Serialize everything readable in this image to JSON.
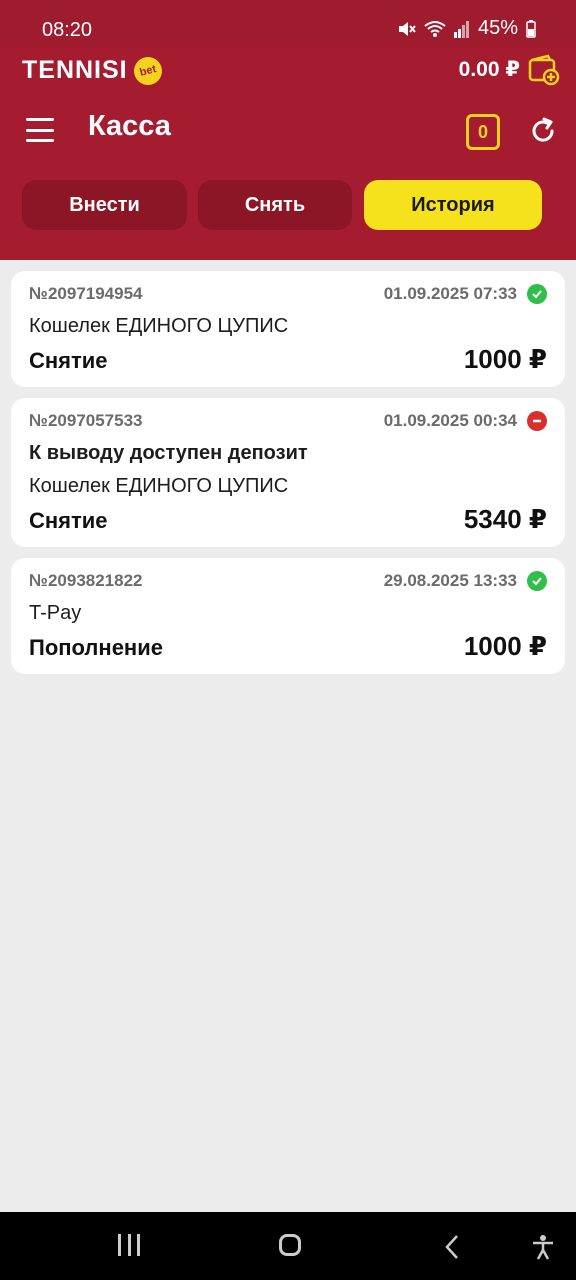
{
  "status_bar": {
    "time": "08:20",
    "battery": "45%",
    "icons": [
      "mute-icon",
      "wifi-icon",
      "signal-icon",
      "battery-icon"
    ]
  },
  "header": {
    "logo_text": "TENNISI",
    "logo_badge": "bet",
    "balance": "0.00 ₽",
    "title": "Касса",
    "coupon_count": "0"
  },
  "tabs": [
    {
      "label": "Внести",
      "active": false
    },
    {
      "label": "Снять",
      "active": false
    },
    {
      "label": "История",
      "active": true
    }
  ],
  "transactions": [
    {
      "number": "№2097194954",
      "datetime": "01.09.2025 07:33",
      "status": "success",
      "lines": [
        "Кошелек ЕДИНОГО ЦУПИС"
      ],
      "type": "Снятие",
      "amount": "1000 ₽"
    },
    {
      "number": "№2097057533",
      "datetime": "01.09.2025 00:34",
      "status": "rejected",
      "lines": [
        "К выводу доступен депозит",
        "Кошелек ЕДИНОГО ЦУПИС"
      ],
      "type": "Снятие",
      "amount": "5340 ₽"
    },
    {
      "number": "№2093821822",
      "datetime": "29.08.2025 13:33",
      "status": "success",
      "lines": [
        "T-Pay"
      ],
      "type": "Пополнение",
      "amount": "1000 ₽"
    }
  ],
  "colors": {
    "brand": "#a51c30",
    "accent": "#f5e11c",
    "success": "#2fbf4a",
    "rejected": "#d9302b"
  }
}
